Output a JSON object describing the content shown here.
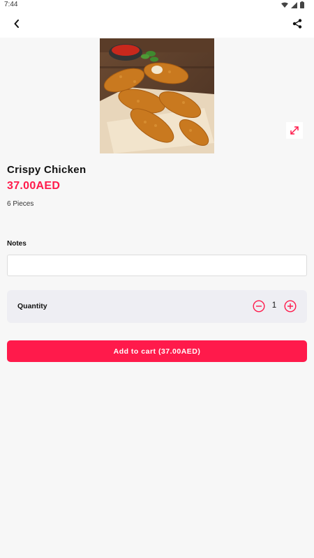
{
  "status_bar": {
    "time": "7:44",
    "icons": [
      "wifi-icon",
      "signal-icon",
      "battery-icon"
    ]
  },
  "app_bar": {
    "back_icon": "chevron-left-icon",
    "share_icon": "share-icon"
  },
  "product": {
    "image_icon": "food-photo",
    "expand_icon": "expand-icon",
    "title": "Crispy Chicken",
    "price": "37.00AED",
    "description": "6 Pieces"
  },
  "notes": {
    "label": "Notes",
    "value": "",
    "placeholder": ""
  },
  "quantity": {
    "label": "Quantity",
    "value": "1",
    "minus_icon": "minus-circle-icon",
    "plus_icon": "plus-circle-icon"
  },
  "cart_button": {
    "label": "Add to cart (37.00AED)"
  },
  "colors": {
    "accent": "#ff1a4b",
    "background": "#f7f7f7",
    "quantity_bg": "#eeeef3"
  }
}
